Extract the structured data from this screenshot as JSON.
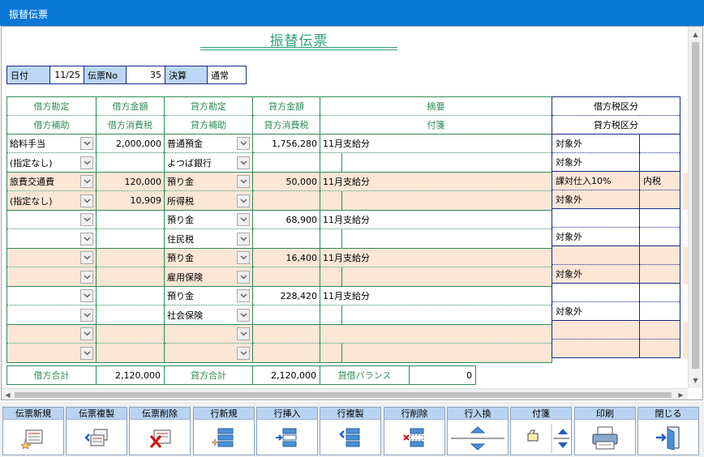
{
  "window": {
    "title": "振替伝票"
  },
  "doc_title": "振替伝票",
  "header": {
    "date_label": "日付",
    "date_value": "11/25",
    "slip_no_label": "伝票No",
    "slip_no_value": "35",
    "settle_label": "決算",
    "settle_value": "通常"
  },
  "columns": {
    "r1": [
      "借方勘定",
      "借方金額",
      "貸方勘定",
      "貸方金額",
      "摘要"
    ],
    "r2": [
      "借方補助",
      "借方消費税",
      "貸方補助",
      "貸方消費税",
      "付箋"
    ],
    "tax_r1": "借方税区分",
    "tax_r2": "貸方税区分"
  },
  "rows": [
    {
      "a": {
        "debit_acct": "給料手当",
        "debit_amt": "2,000,000",
        "credit_acct": "普通預金",
        "credit_amt": "1,756,280",
        "memo": "11月支給分",
        "tax1": "対象外",
        "tax2": ""
      },
      "b": {
        "debit_sub": "(指定なし)",
        "debit_tax": "",
        "credit_sub": "よつば銀行",
        "credit_tax": "",
        "note": "",
        "tax1": "対象外"
      }
    },
    {
      "a": {
        "debit_acct": "旅費交通費",
        "debit_amt": "120,000",
        "credit_acct": "預り金",
        "credit_amt": "50,000",
        "memo": "11月支給分",
        "tax1": "課対仕入10%",
        "tax2": "内税"
      },
      "b": {
        "debit_sub": "(指定なし)",
        "debit_tax": "10,909",
        "credit_sub": "所得税",
        "credit_tax": "",
        "note": "",
        "tax1": "対象外"
      }
    },
    {
      "a": {
        "debit_acct": "",
        "debit_amt": "",
        "credit_acct": "預り金",
        "credit_amt": "68,900",
        "memo": "11月支給分",
        "tax1": "",
        "tax2": ""
      },
      "b": {
        "debit_sub": "",
        "debit_tax": "",
        "credit_sub": "住民税",
        "credit_tax": "",
        "note": "",
        "tax1": "対象外"
      }
    },
    {
      "a": {
        "debit_acct": "",
        "debit_amt": "",
        "credit_acct": "預り金",
        "credit_amt": "16,400",
        "memo": "11月支給分",
        "tax1": "",
        "tax2": ""
      },
      "b": {
        "debit_sub": "",
        "debit_tax": "",
        "credit_sub": "雇用保険",
        "credit_tax": "",
        "note": "",
        "tax1": "対象外"
      }
    },
    {
      "a": {
        "debit_acct": "",
        "debit_amt": "",
        "credit_acct": "預り金",
        "credit_amt": "228,420",
        "memo": "11月支給分",
        "tax1": "",
        "tax2": ""
      },
      "b": {
        "debit_sub": "",
        "debit_tax": "",
        "credit_sub": "社会保険",
        "credit_tax": "",
        "note": "",
        "tax1": "対象外"
      }
    },
    {
      "a": {
        "debit_acct": "",
        "debit_amt": "",
        "credit_acct": "",
        "credit_amt": "",
        "memo": "",
        "tax1": "",
        "tax2": ""
      },
      "b": {
        "debit_sub": "",
        "debit_tax": "",
        "credit_sub": "",
        "credit_tax": "",
        "note": "",
        "tax1": ""
      }
    }
  ],
  "totals": {
    "debit_label": "借方合計",
    "debit_value": "2,120,000",
    "credit_label": "貸方合計",
    "credit_value": "2,120,000",
    "balance_label": "貸借バランス",
    "balance_value": "0"
  },
  "toolbar": [
    {
      "label": "伝票新規",
      "icon": "new-slip-icon"
    },
    {
      "label": "伝票複製",
      "icon": "copy-slip-icon"
    },
    {
      "label": "伝票削除",
      "icon": "delete-slip-icon"
    },
    {
      "label": "行新規",
      "icon": "new-row-icon"
    },
    {
      "label": "行挿入",
      "icon": "insert-row-icon"
    },
    {
      "label": "行複製",
      "icon": "copy-row-icon"
    },
    {
      "label": "行削除",
      "icon": "delete-row-icon"
    },
    {
      "label": "行入換",
      "icon": "swap-rows-icon"
    },
    {
      "label": "付箋",
      "icon": "sticky-note-icon"
    },
    {
      "label": "印刷",
      "icon": "printer-icon"
    },
    {
      "label": "閉じる",
      "icon": "exit-door-icon"
    }
  ],
  "colors": {
    "titlebar": "#0a78d7",
    "grid_line": "#2e8b57",
    "tax_line": "#1a2a8a",
    "pink_row": "#fce6d6",
    "label_blue": "#bcd7f6"
  }
}
